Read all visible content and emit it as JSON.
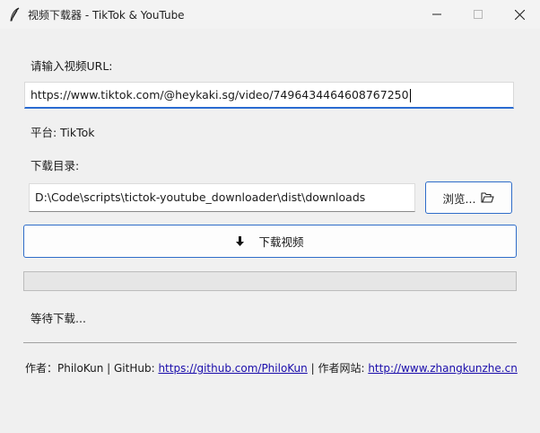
{
  "window": {
    "title": "视频下载器 - TikTok & YouTube",
    "icon": "feather-icon"
  },
  "form": {
    "url_label": "请输入视频URL:",
    "url_value": "https://www.tiktok.com/@heykaki.sg/video/7496434464608767250",
    "platform_text": "平台: TikTok",
    "dir_label": "下载目录:",
    "dir_value": "D:\\Code\\scripts\\tictok-youtube_downloader\\dist\\downloads",
    "browse_label": "浏览...",
    "download_label": "下载视频"
  },
  "progress": {
    "fraction": 0
  },
  "status": {
    "text": "等待下载..."
  },
  "footer": {
    "author_text": "作者：PhiloKun | GitHub: ",
    "github_link": "https://github.com/PhiloKun",
    "site_text": " | 作者网站: ",
    "site_link": "http://www.zhangkunzhe.cn"
  },
  "colors": {
    "accent": "#2f6dc9",
    "link": "#1a0dab"
  }
}
